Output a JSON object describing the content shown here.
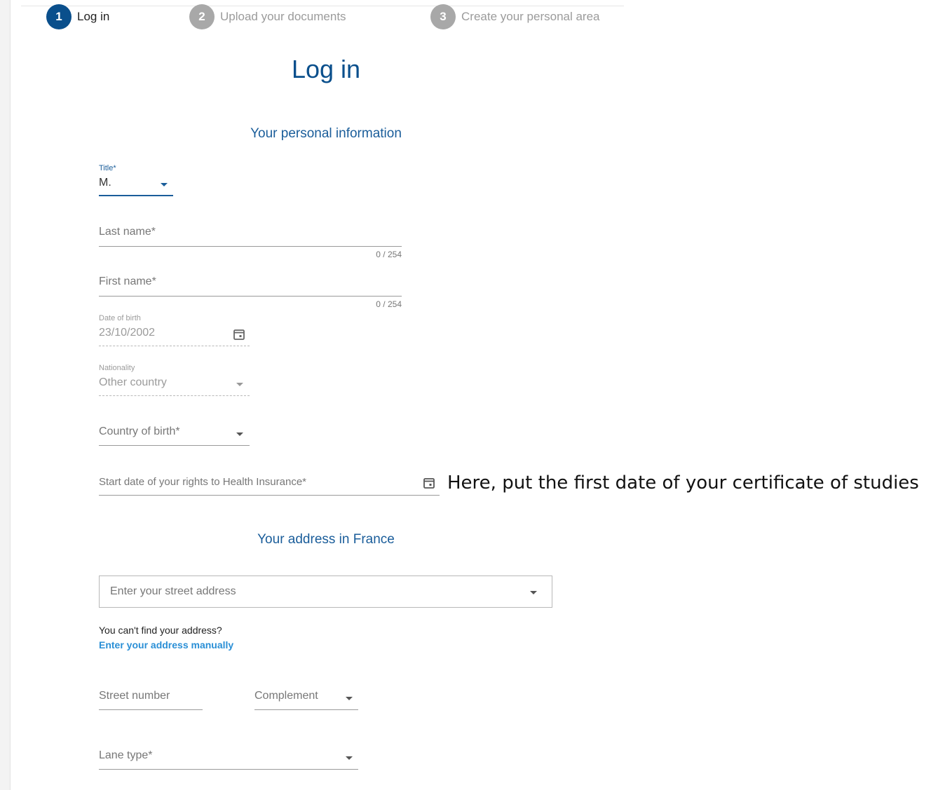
{
  "stepper": {
    "steps": [
      {
        "number": "1",
        "label": "Log in"
      },
      {
        "number": "2",
        "label": "Upload your documents"
      },
      {
        "number": "3",
        "label": "Create your personal area"
      }
    ]
  },
  "page_title": "Log in",
  "personal_section": {
    "title": "Your personal information",
    "title_field": {
      "label": "Title*",
      "value": "M."
    },
    "last_name": {
      "placeholder": "Last name*",
      "counter": "0 / 254"
    },
    "first_name": {
      "placeholder": "First name*",
      "counter": "0 / 254"
    },
    "date_of_birth": {
      "label": "Date of birth",
      "value": "23/10/2002",
      "icon": "calendar-icon"
    },
    "nationality": {
      "label": "Nationality",
      "value": "Other country"
    },
    "country_of_birth": {
      "placeholder": "Country of birth*"
    },
    "health_insurance": {
      "placeholder": "Start date of your rights to Health Insurance*",
      "icon": "calendar-icon"
    }
  },
  "annotation": "Here, put the first date of your certificate of studies",
  "address_section": {
    "title": "Your address in France",
    "street_address": {
      "placeholder": "Enter your street address"
    },
    "help_text": "You can't find your address?",
    "manual_link": "Enter your address manually",
    "street_number": {
      "placeholder": "Street number"
    },
    "complement": {
      "placeholder": "Complement"
    },
    "lane_type": {
      "placeholder": "Lane type*"
    }
  },
  "colors": {
    "primary": "#0a4f8c",
    "section_title": "#1a5d9a",
    "link": "#2a8fd6",
    "inactive_step": "#a8a8a8"
  }
}
